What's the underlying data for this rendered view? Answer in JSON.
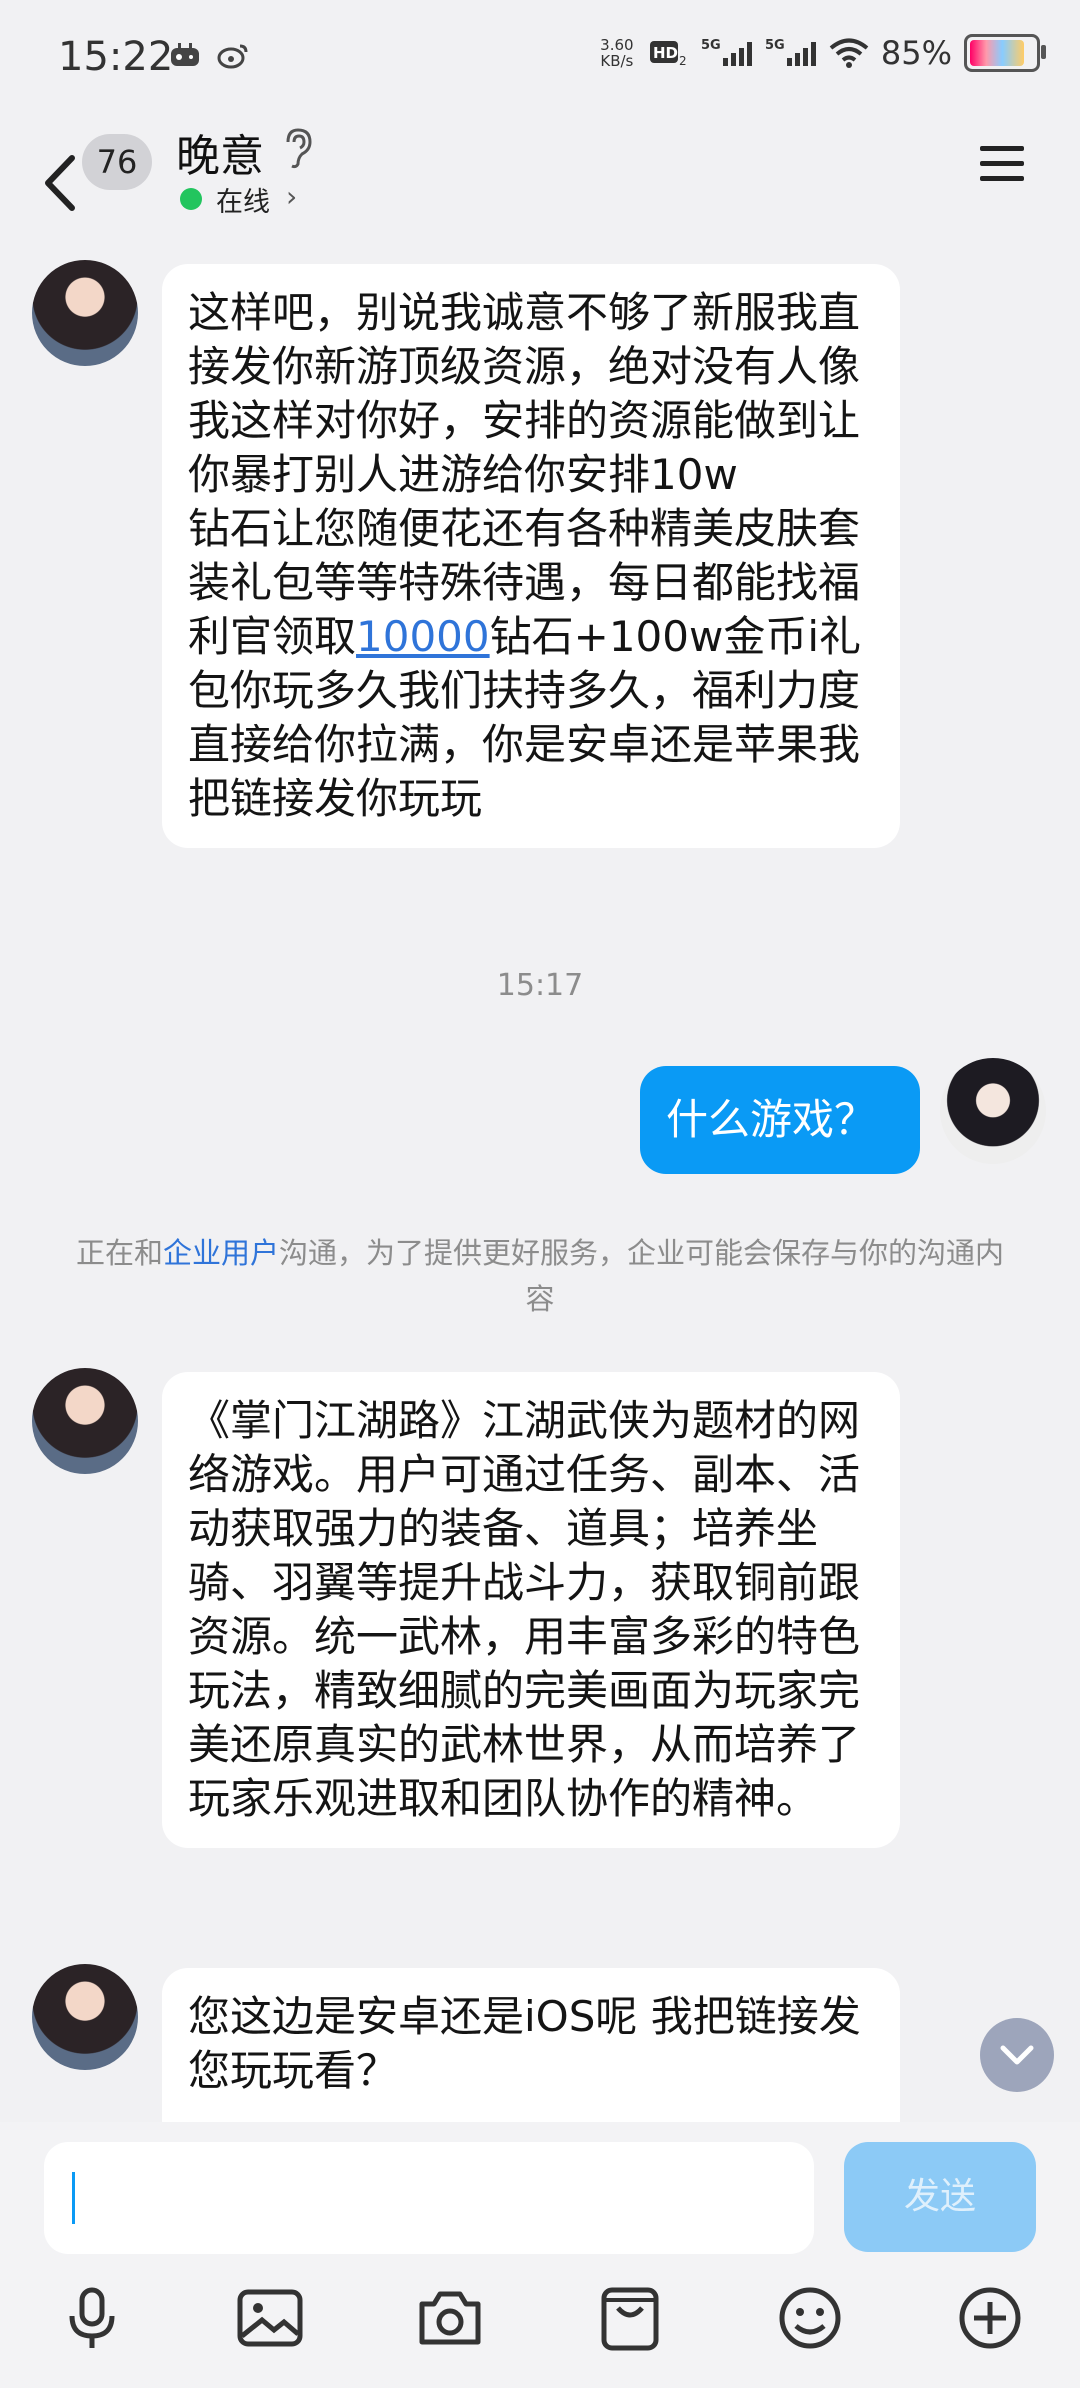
{
  "status_bar": {
    "time": "15:22",
    "net_speed_value": "3.60",
    "net_speed_unit": "KB/s",
    "battery_percent": "85%"
  },
  "header": {
    "unread_count": "76",
    "contact_name": "晚意",
    "status": "在线"
  },
  "messages": {
    "m1": "这样吧，别说我诚意不够了新服我直接发你新游顶级资源，绝对没有人像我这样对你好，安排的资源能做到让你暴打别人进游给你安排10w",
    "m1_line2_pre": "钻石让您随便花还有各种精美皮肤套装礼包等等特殊待遇，每日都能找福利官领取",
    "m1_link": "10000",
    "m1_line2_post": "钻石+100w金币i礼包你玩多久我们扶持多久，福利力度直接给你拉满，你是安卓还是苹果我把链接发你玩玩",
    "timestamp": "15:17",
    "m2": "什么游戏？",
    "notice_pre": "正在和",
    "notice_link": "企业用户",
    "notice_post": "沟通，为了提供更好服务，企业可能会保存与你的沟通内容",
    "m3": "《掌门江湖路》江湖武侠为题材的网络游戏。用户可通过任务、副本、活动获取强力的装备、道具；培养坐骑、羽翼等提升战斗力，获取铜前跟资源。统一武林，用丰富多彩的特色玩法，精致细腻的完美画面为玩家完美还原真实的武林世界，从而培养了玩家乐观进取和团队协作的精神。",
    "m4": "您这边是安卓还是iOS呢 我把链接发您玩玩看？"
  },
  "input": {
    "value": "",
    "send_label": "发送"
  },
  "toolbar_icons": [
    "microphone-icon",
    "image-icon",
    "camera-icon",
    "wallet-icon",
    "emoji-icon",
    "plus-icon"
  ],
  "colors": {
    "accent": "#0a9af5",
    "online": "#22c55e",
    "link": "#2f74d9"
  }
}
